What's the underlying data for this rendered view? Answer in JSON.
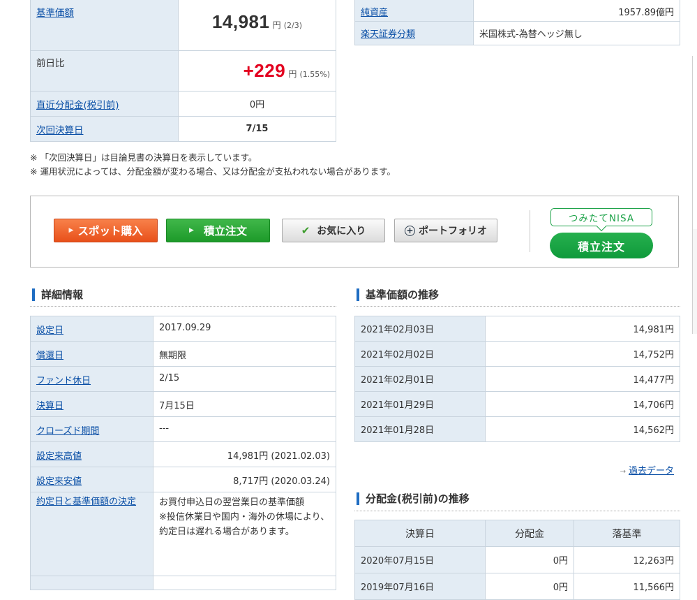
{
  "price": {
    "nav_label": "基準価額",
    "nav_value": "14,981",
    "nav_unit": "円",
    "nav_date": "(2/3)",
    "change_label": "前日比",
    "change_value": "+229",
    "change_unit": "円",
    "change_pct": "(1.55%)",
    "dist_label": "直近分配金(税引前)",
    "dist_value": "0円",
    "settle_label": "次回決算日",
    "settle_value": "7/15"
  },
  "fund": {
    "net_assets_label": "純資産",
    "net_assets_value": "1957.89億円",
    "category_label": "楽天証券分類",
    "category_value": "米国株式-為替ヘッジ無し"
  },
  "notes": [
    "※ 「次回決算日」は目論見書の決算日を表示しています。",
    "※ 運用状況によっては、分配金額が変わる場合、又は分配金が支払われない場合があります。"
  ],
  "order": {
    "spot_label": "スポット購入",
    "tsumitate_label": "積立注文",
    "favorite_label": "お気に入り",
    "portfolio_label": "ポートフォリオ",
    "nisa_tag": "つみたてNISA",
    "nisa_button": "積立注文"
  },
  "detail": {
    "heading": "詳細情報",
    "rows": [
      {
        "label": "設定日",
        "value": "2017.09.29"
      },
      {
        "label": "償還日",
        "value": "無期限"
      },
      {
        "label": "ファンド休日",
        "value": "2/15"
      },
      {
        "label": "決算日",
        "value": "7月15日"
      },
      {
        "label": "クローズド期間",
        "value": "---"
      },
      {
        "label": "設定来高値",
        "value": "14,981円 (2021.02.03)"
      },
      {
        "label": "設定来安値",
        "value": "8,717円 (2020.03.24)"
      },
      {
        "label": "約定日と基準価額の決定",
        "value": "お買付申込日の翌営業日の基準価額\n※投信休業日や国内・海外の休場により、約定日は遅れる場合があります。"
      }
    ]
  },
  "history": {
    "heading": "基準価額の推移",
    "rows": [
      {
        "date": "2021年02月03日",
        "value": "14,981円"
      },
      {
        "date": "2021年02月02日",
        "value": "14,752円"
      },
      {
        "date": "2021年02月01日",
        "value": "14,477円"
      },
      {
        "date": "2021年01月29日",
        "value": "14,706円"
      },
      {
        "date": "2021年01月28日",
        "value": "14,562円"
      }
    ],
    "past_link": "過去データ"
  },
  "dividend": {
    "heading": "分配金(税引前)の推移",
    "columns": [
      "決算日",
      "分配金",
      "落基準"
    ],
    "rows": [
      {
        "date": "2020年07月15日",
        "amount": "0円",
        "nav": "12,263円"
      },
      {
        "date": "2019年07月16日",
        "amount": "0円",
        "nav": "11,566円"
      }
    ]
  }
}
